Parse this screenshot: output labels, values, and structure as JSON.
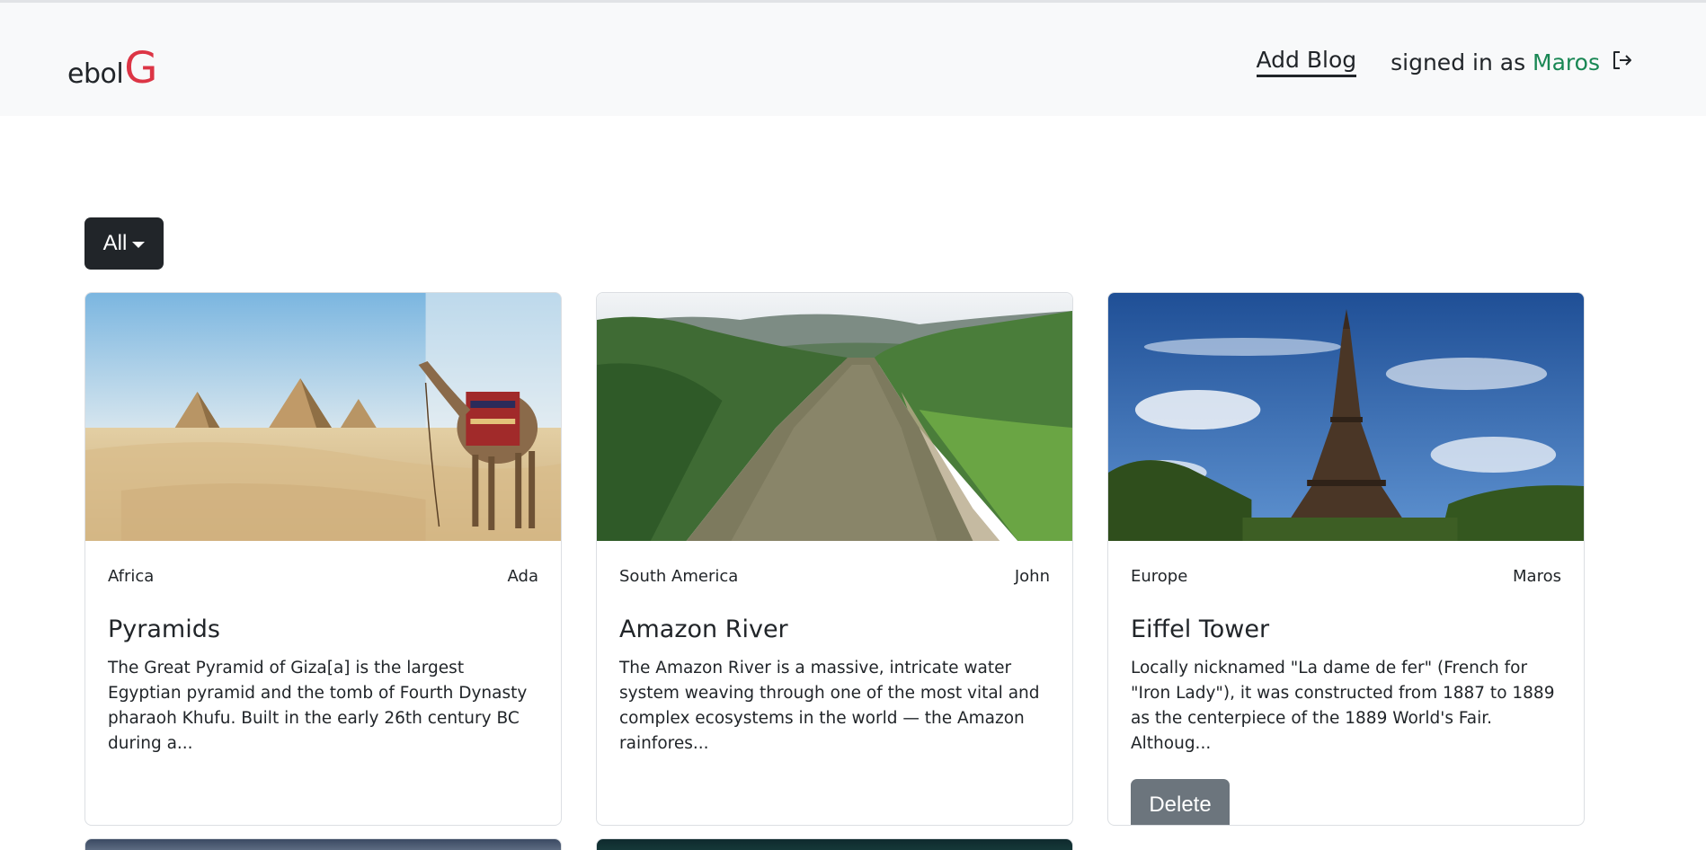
{
  "brand": {
    "text": "ebol",
    "accent": "G",
    "accent_color": "#dc3545"
  },
  "nav": {
    "add_blog": "Add Blog",
    "signed_in_prefix": "signed in as",
    "username": "Maros",
    "logout_icon": "logout-icon"
  },
  "filter": {
    "selected": "All"
  },
  "posts": [
    {
      "region": "Africa",
      "author": "Ada",
      "title": "Pyramids",
      "excerpt": "The Great Pyramid of Giza[a] is the largest Egyptian pyramid and the tomb of Fourth Dynasty pharaoh Khufu. Built in the early 26th century BC during a...",
      "image": "pyramids-with-camel"
    },
    {
      "region": "South America",
      "author": "John",
      "title": "Amazon River",
      "excerpt": "The Amazon River is a massive, intricate water system weaving through one of the most vital and complex ecosystems in the world — the Amazon rainfores...",
      "image": "amazon-river-aerial"
    },
    {
      "region": "Europe",
      "author": "Maros",
      "title": "Eiffel Tower",
      "excerpt": "Locally nicknamed \"La dame de fer\" (French for \"Iron Lady\"), it was constructed from 1887 to 1889 as the centerpiece of the 1889 World's Fair. Althoug...",
      "image": "eiffel-tower-blue-sky",
      "delete_label": "Delete"
    }
  ],
  "colors": {
    "success": "#198754",
    "dark": "#212529",
    "secondary": "#6c757d"
  }
}
